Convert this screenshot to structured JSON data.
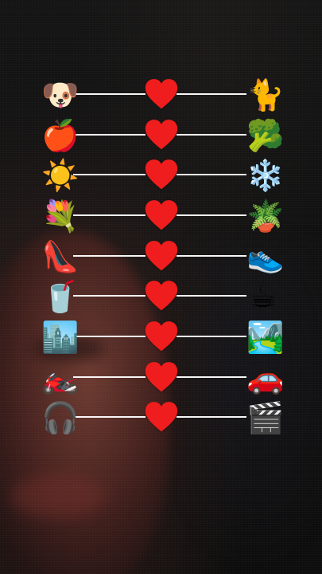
{
  "pairs": [
    {
      "left_icon": "🐶",
      "right_icon": "🐈"
    },
    {
      "left_icon": "🍎",
      "right_icon": "🥦"
    },
    {
      "left_icon": "☀️",
      "right_icon": "❄️"
    },
    {
      "left_icon": "💐",
      "right_icon": "🪴"
    },
    {
      "left_icon": "👠",
      "right_icon": "👟"
    },
    {
      "left_icon": "🥤",
      "right_icon": "☕"
    },
    {
      "left_icon": "🏙️",
      "right_icon": "🏞️"
    },
    {
      "left_icon": "🏍️",
      "right_icon": "🚗"
    },
    {
      "left_icon": "🎧",
      "right_icon": "🎬"
    }
  ],
  "icons": {
    "heart": "heart-icon"
  },
  "colors": {
    "heart": "#ef1d1d",
    "line": "#ffffff"
  }
}
